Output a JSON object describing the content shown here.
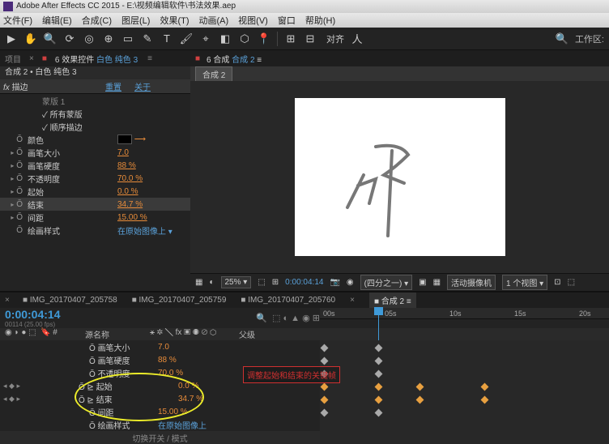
{
  "title": "Adobe After Effects CC 2015 - E:\\视频编辑软件\\书法效果.aep",
  "menus": [
    "文件(F)",
    "编辑(E)",
    "合成(C)",
    "图层(L)",
    "效果(T)",
    "动画(A)",
    "视图(V)",
    "窗口",
    "帮助(H)"
  ],
  "workspace_label": "工作区:",
  "align_label": "对齐",
  "left_tabs": {
    "project": "项目",
    "effect_controls": "效果控件",
    "layer_name": "白色 纯色 3"
  },
  "comp_path": "合成 2 • 白色 纯色 3",
  "effect": {
    "name": "描边",
    "reset": "重置",
    "about": "关于",
    "props": [
      {
        "name": "蒙版 1",
        "value": "",
        "indent": 1,
        "blue": false
      },
      {
        "name": "所有蒙版",
        "value": "",
        "indent": 1,
        "check": true
      },
      {
        "name": "顺序描边",
        "value": "",
        "indent": 1,
        "check": true
      },
      {
        "name": "颜色",
        "value": "swatch",
        "indent": 0
      },
      {
        "name": "画笔大小",
        "value": "7.0",
        "indent": 0
      },
      {
        "name": "画笔硬度",
        "value": "88 %",
        "indent": 0
      },
      {
        "name": "不透明度",
        "value": "70.0 %",
        "indent": 0
      },
      {
        "name": "起始",
        "value": "0.0 %",
        "indent": 0
      },
      {
        "name": "结束",
        "value": "34.7 %",
        "indent": 0,
        "hl": true
      },
      {
        "name": "间距",
        "value": "15.00 %",
        "indent": 0
      },
      {
        "name": "绘画样式",
        "value": "在原始图像上",
        "indent": 0,
        "blue": true
      }
    ]
  },
  "viewer": {
    "tab_prefix": "6",
    "tab_label": "合成",
    "tab_name": "合成 2",
    "comp_chip": "合成 2",
    "zoom": "25%",
    "time": "0:00:04:14",
    "view": "(四分之一)",
    "camera": "活动摄像机",
    "views": "1 个视图"
  },
  "timeline": {
    "tabs": [
      "IMG_20170407_205758",
      "IMG_20170407_205759",
      "IMG_20170407_205760",
      "合成 2"
    ],
    "active_tab": 3,
    "timecode": "0:00:04:14",
    "framecount": "00114 (25.00 fps)",
    "col_source": "源名称",
    "col_parent": "父级",
    "ruler": [
      "00s",
      "05s",
      "10s",
      "15s",
      "20s"
    ],
    "props": [
      {
        "name": "画笔大小",
        "value": "7.0"
      },
      {
        "name": "画笔硬度",
        "value": "88 %"
      },
      {
        "name": "不透明度",
        "value": "70.0 %"
      },
      {
        "name": "起始",
        "value": "0.0 %",
        "key": true
      },
      {
        "name": "结束",
        "value": "34.7 %",
        "key": true
      },
      {
        "name": "间距",
        "value": "15.00 %"
      },
      {
        "name": "绘画样式",
        "value": "在原始图像上"
      }
    ],
    "switch_label": "切换开关 / 模式"
  },
  "annotation": "调整起始和结束的关键帧"
}
